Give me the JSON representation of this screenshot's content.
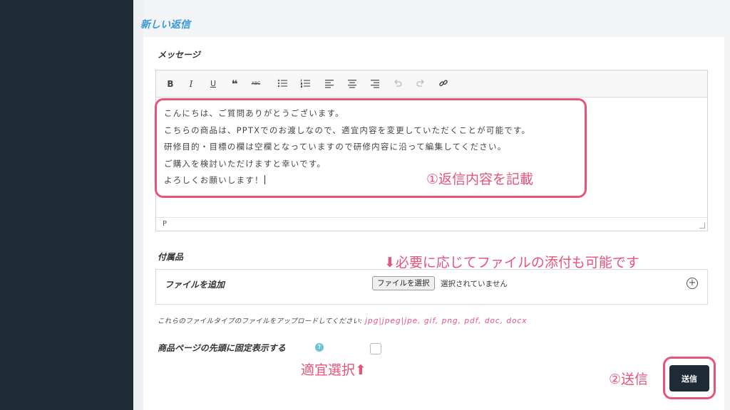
{
  "section_title": "新しい返信",
  "message": {
    "label": "メッセージ",
    "toolbar": {
      "bold": "B",
      "italic": "I",
      "underline": "U",
      "quote": "❝",
      "strike": "ABC"
    },
    "body_lines": [
      "こんにちは、ご質問ありがとうございます。",
      "こちらの商品は、PPTXでのお渡しなので、適宜内容を変更していただくことが可能です。",
      "研修目的・目標の欄は空欄となっていますので研修内容に沿って編集してください。",
      "ご購入を検討いただけますと幸いです。",
      "よろしくお願いします！"
    ],
    "status_path": "P"
  },
  "attachments": {
    "label": "付属品",
    "add_file_label": "ファイルを追加",
    "choose_file_button": "ファイルを選択",
    "no_file_text": "選択されていません",
    "allowed_types_prefix": "これらのファイルタイプのファイルをアップロードしてください:",
    "allowed_types": "jpg|jpeg|jpe, gif, png, pdf, doc, docx"
  },
  "pin": {
    "label": "商品ページの先頭に固定表示する",
    "info_glyph": "?",
    "checked": false
  },
  "send_button": "送信",
  "annotations": {
    "reply": "①返信内容を記載",
    "file": "⬇必要に応じてファイルの添付も可能です",
    "select": "適宜選択⬆",
    "send": "②送信"
  },
  "colors": {
    "sidebar": "#1e2a35",
    "accent_title": "#3a9ad9",
    "annotation": "#e8537a",
    "send_button": "#1e2a35"
  }
}
